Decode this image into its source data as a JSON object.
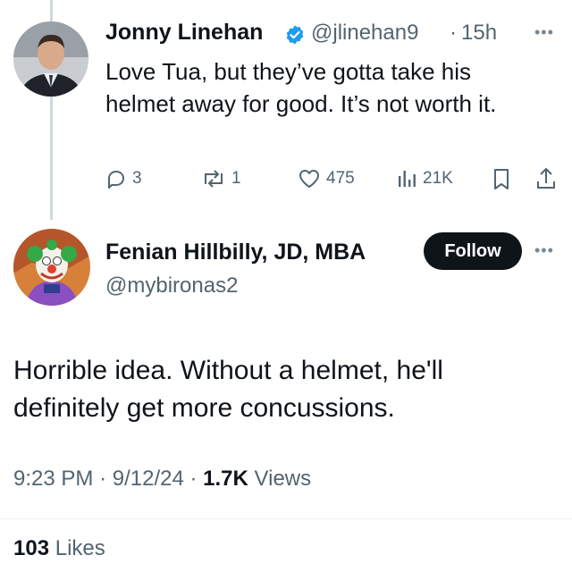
{
  "reply_to": {
    "name": "Jonny Linehan",
    "handle": "@jlinehan9",
    "separator": "·",
    "time": "15h",
    "text": "Love Tua, but they’ve gotta take his helmet away for good. It’s not worth it.",
    "stats": {
      "replies": "3",
      "reposts": "1",
      "likes": "475",
      "views": "21K"
    },
    "verified_badge_color": "#1d9bf0"
  },
  "tweet": {
    "name": "Fenian Hillbilly, JD, MBA",
    "handle": "@mybironas2",
    "follow_label": "Follow",
    "text": "Horrible idea. Without a helmet, he'll definitely get more concussions.",
    "time": "9:23 PM",
    "date": "9/12/24",
    "separator": "·",
    "views_count": "1.7K",
    "views_label": "Views",
    "likes_count": "103",
    "likes_label": "Likes"
  },
  "icons": [
    "verified-icon",
    "more-icon",
    "reply-icon",
    "repost-icon",
    "like-icon",
    "views-icon",
    "bookmark-icon",
    "share-icon"
  ]
}
